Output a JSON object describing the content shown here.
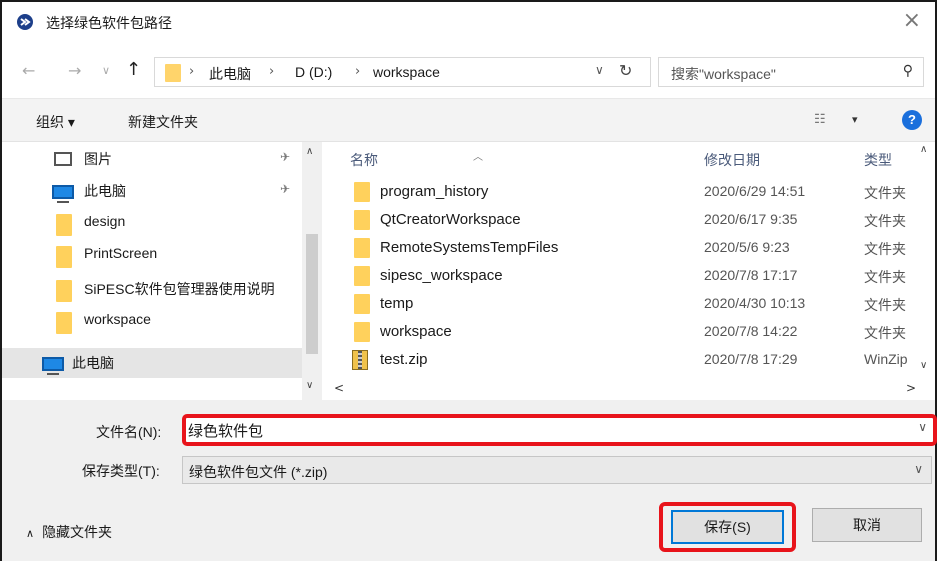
{
  "window": {
    "title": "选择绿色软件包路径",
    "close_glyph": "×"
  },
  "nav": {
    "back_glyph": "←",
    "forward_glyph": "→",
    "recent_glyph": "∨",
    "up_glyph": "↑",
    "breadcrumb": [
      "此电脑",
      "D (D:)",
      "workspace"
    ],
    "crumb_sep": "›",
    "dropdown_glyph": "∨",
    "refresh_glyph": "↻",
    "search_placeholder": "搜索\"workspace\"",
    "search_glyph": "⚲"
  },
  "toolbar": {
    "organize_label": "组织 ▾",
    "new_folder_label": "新建文件夹",
    "view_glyph": "☷",
    "view_dd_glyph": "▾",
    "help_glyph": "?"
  },
  "tree": {
    "items": [
      {
        "label": "图片",
        "icon": "picture-icon",
        "pinned": true
      },
      {
        "label": "此电脑",
        "icon": "computer-icon",
        "pinned": true
      },
      {
        "label": "design",
        "icon": "folder-icon",
        "pinned": false
      },
      {
        "label": "PrintScreen",
        "icon": "folder-icon",
        "pinned": false
      },
      {
        "label": "SiPESC软件包管理器使用说明",
        "icon": "folder-icon",
        "pinned": false
      },
      {
        "label": "workspace",
        "icon": "folder-icon",
        "pinned": false
      },
      {
        "label": "此电脑",
        "icon": "computer-icon",
        "pinned": false,
        "selected": true
      }
    ],
    "pin_glyph": "✈",
    "scroll_up": "∧",
    "scroll_down": "∨"
  },
  "files": {
    "columns": {
      "name": "名称",
      "date": "修改日期",
      "type": "类型",
      "sort_glyph": "︿"
    },
    "rows": [
      {
        "name": "program_history",
        "date": "2020/6/29 14:51",
        "type": "文件夹",
        "icon": "folder-icon"
      },
      {
        "name": "QtCreatorWorkspace",
        "date": "2020/6/17 9:35",
        "type": "文件夹",
        "icon": "folder-icon"
      },
      {
        "name": "RemoteSystemsTempFiles",
        "date": "2020/5/6 9:23",
        "type": "文件夹",
        "icon": "folder-icon"
      },
      {
        "name": "sipesc_workspace",
        "date": "2020/7/8 17:17",
        "type": "文件夹",
        "icon": "folder-icon"
      },
      {
        "name": "temp",
        "date": "2020/4/30 10:13",
        "type": "文件夹",
        "icon": "folder-icon"
      },
      {
        "name": "workspace",
        "date": "2020/7/8 14:22",
        "type": "文件夹",
        "icon": "folder-icon"
      },
      {
        "name": "test.zip",
        "date": "2020/7/8 17:29",
        "type": "WinZip",
        "icon": "zip-icon"
      }
    ],
    "scroll_left": "<",
    "scroll_right": ">",
    "scroll_up": "∧",
    "scroll_down": "∨"
  },
  "form": {
    "filename_label": "文件名(N):",
    "filename_value": "绿色软件包",
    "filetype_label": "保存类型(T):",
    "filetype_value": "绿色软件包文件 (*.zip)",
    "dropdown_glyph": "∨",
    "hide_folders_caret": "∧",
    "hide_folders_label": "隐藏文件夹",
    "save_label": "保存(S)",
    "cancel_label": "取消"
  },
  "colors": {
    "highlight_red": "#e8141b",
    "accent_blue": "#0078d7",
    "folder_yellow": "#ffd15c"
  }
}
